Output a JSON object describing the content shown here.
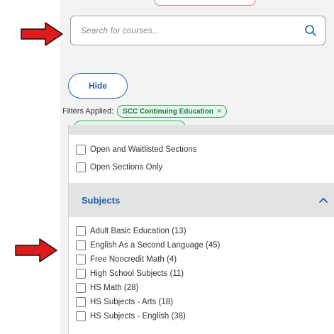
{
  "search": {
    "placeholder": "Search for courses..."
  },
  "hide_button": {
    "label": "Hide"
  },
  "filters": {
    "label": "Filters Applied:",
    "chips": [
      {
        "label": "SCC Continuing Education",
        "remove": "×"
      }
    ]
  },
  "availability": {
    "options": [
      {
        "label": "Open and Waitlisted Sections",
        "checked": false
      },
      {
        "label": "Open Sections Only",
        "checked": false
      }
    ]
  },
  "subjects": {
    "title": "Subjects",
    "items": [
      {
        "label": "Adult Basic Education (13)",
        "checked": false
      },
      {
        "label": "English As a Second Language (45)",
        "checked": false
      },
      {
        "label": "Free Noncredit Math (4)",
        "checked": false
      },
      {
        "label": "High School Subjects (11)",
        "checked": false
      },
      {
        "label": "HS Math (28)",
        "checked": false
      },
      {
        "label": "HS Subjects - Arts (18)",
        "checked": false
      },
      {
        "label": "HS Subjects - English (38)",
        "checked": false
      }
    ]
  },
  "colors": {
    "annotation_arrow": "#e01b1b",
    "link_blue": "#1d5fa6",
    "chip_green": "#3aa35c"
  }
}
